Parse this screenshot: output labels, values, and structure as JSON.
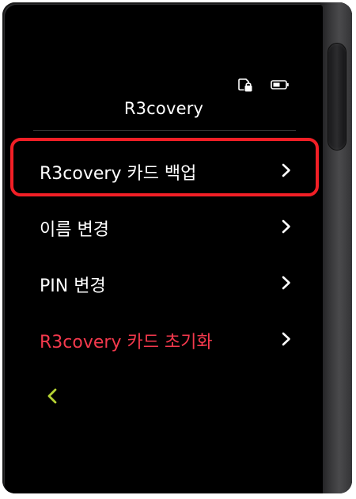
{
  "header": {
    "title": "R3covery",
    "icons": [
      "card-lock-icon",
      "battery-icon"
    ]
  },
  "menu": {
    "items": [
      {
        "label": "R3covery 카드 백업",
        "icon": "chevron-right-icon",
        "highlighted": true
      },
      {
        "label": "이름 변경",
        "icon": "chevron-right-icon"
      },
      {
        "label": "PIN 변경",
        "icon": "chevron-right-icon"
      },
      {
        "label": "R3covery 카드 초기화",
        "icon": "chevron-right-icon",
        "danger": true
      }
    ]
  },
  "navigation": {
    "back_icon": "chevron-left-icon"
  },
  "colors": {
    "background": "#000000",
    "text": "#ffffff",
    "danger": "#f4394d",
    "highlight": "#f21f26",
    "back_accent": "#b5d334"
  }
}
